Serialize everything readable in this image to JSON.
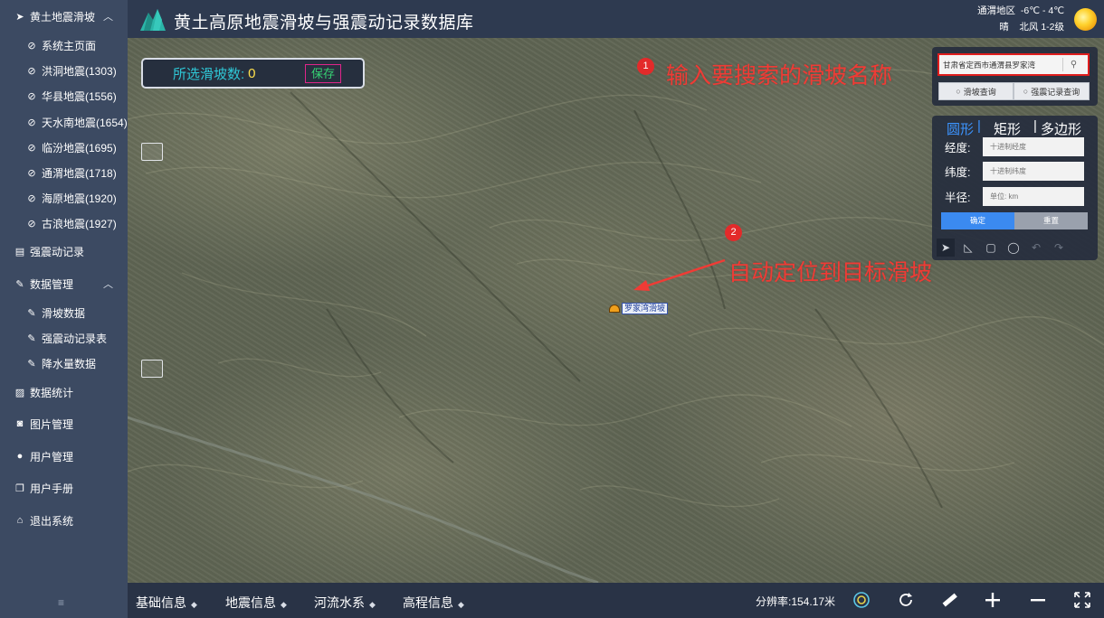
{
  "app": {
    "title": "黄土高原地震滑坡与强震动记录数据库"
  },
  "weather": {
    "location": "通渭地区",
    "temperature": "-6℃ - 4℃",
    "condition": "晴",
    "wind": "北风 1-2级"
  },
  "sidebar": {
    "sections": [
      {
        "label": "黄土地震滑坡",
        "icon": "navigation-icon",
        "expanded": true
      },
      {
        "label": "强震动记录",
        "icon": "document-icon"
      },
      {
        "label": "数据管理",
        "icon": "edit-icon",
        "expanded": true
      },
      {
        "label": "数据统计",
        "icon": "chart-icon"
      },
      {
        "label": "图片管理",
        "icon": "camera-icon"
      },
      {
        "label": "用户管理",
        "icon": "user-icon"
      },
      {
        "label": "用户手册",
        "icon": "book-icon"
      },
      {
        "label": "退出系统",
        "icon": "home-icon"
      }
    ],
    "landslide_items": [
      "系统主页面",
      "洪洞地震(1303)",
      "华县地震(1556)",
      "天水南地震(1654)",
      "临汾地震(1695)",
      "通渭地震(1718)",
      "海原地震(1920)",
      "古浪地震(1927)"
    ],
    "data_items": [
      "滑坡数据",
      "强震动记录表",
      "降水量数据"
    ]
  },
  "map": {
    "count_label": "所选滑坡数:",
    "count_value": "0",
    "save_label": "保存",
    "landslide_label": "罗家湾滑坡"
  },
  "annotations": {
    "step1_num": "1",
    "step1_text": "输入要搜索的滑坡名称",
    "step2_num": "2",
    "step2_text": "自动定位到目标滑坡"
  },
  "search": {
    "value": "甘肃省定西市通渭县罗家湾",
    "landslide_query": "滑坡查询",
    "record_query": "强震记录查询"
  },
  "shape": {
    "tabs": [
      "圆形",
      "矩形",
      "多边形"
    ],
    "active_tab": "圆形",
    "longitude_label": "经度:",
    "longitude_placeholder": "十进制经度",
    "latitude_label": "纬度:",
    "latitude_placeholder": "十进制纬度",
    "radius_label": "半径:",
    "radius_placeholder": "单位: km",
    "confirm": "确定",
    "reset": "重置"
  },
  "bottombar": {
    "layers": [
      "基础信息",
      "地震信息",
      "河流水系",
      "高程信息"
    ],
    "resolution": "分辨率:154.17米"
  },
  "colors": {
    "sidebar": "#3c4a62",
    "header": "#2e3a50",
    "accent": "#3b8af0",
    "annotation": "#f03b35"
  }
}
